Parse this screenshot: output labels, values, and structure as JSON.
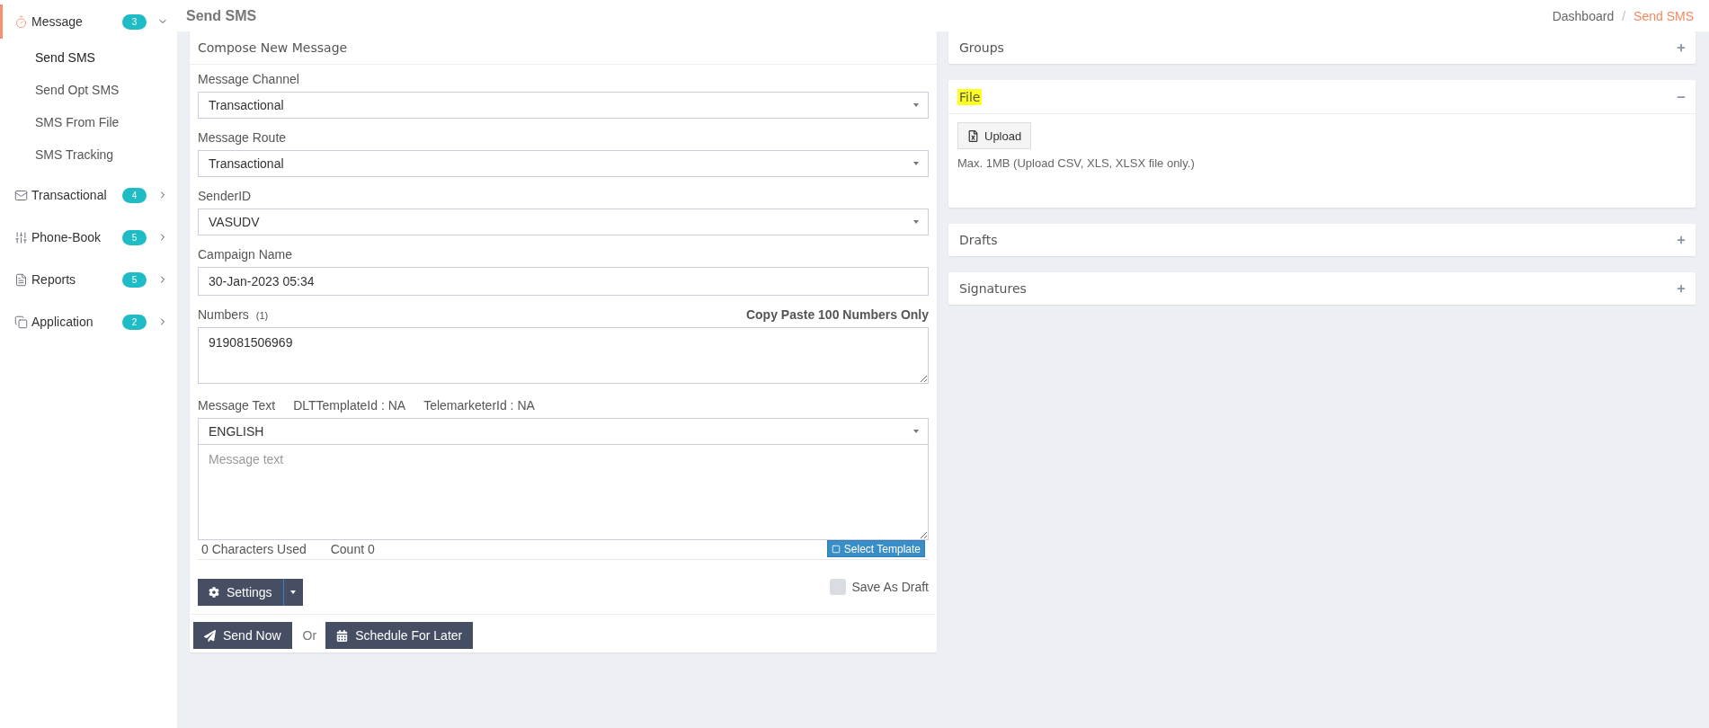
{
  "sidebar": {
    "items": [
      {
        "label": "Message",
        "badge": "3",
        "expanded": true,
        "selected": true,
        "children": [
          {
            "label": "Send SMS",
            "selected": true
          },
          {
            "label": "Send Opt SMS",
            "selected": false
          },
          {
            "label": "SMS From File",
            "selected": false
          },
          {
            "label": "SMS Tracking",
            "selected": false
          }
        ]
      },
      {
        "label": "Transactional",
        "badge": "4",
        "expanded": false,
        "selected": false
      },
      {
        "label": "Phone-Book",
        "badge": "5",
        "expanded": false,
        "selected": false
      },
      {
        "label": "Reports",
        "badge": "5",
        "expanded": false,
        "selected": false
      },
      {
        "label": "Application",
        "badge": "2",
        "expanded": false,
        "selected": false
      }
    ]
  },
  "header": {
    "title": "Send SMS",
    "breadcrumb_separator": "/",
    "breadcrumb": [
      {
        "label": "Dashboard",
        "selected": false
      },
      {
        "label": "Send SMS",
        "selected": true
      }
    ]
  },
  "compose": {
    "title": "Compose New Message",
    "fields": [
      {
        "kind": "select",
        "label": "Message Channel",
        "value": "Transactional"
      },
      {
        "kind": "select",
        "label": "Message Route",
        "value": "Transactional"
      },
      {
        "kind": "select",
        "label": "SenderID",
        "value": "VASUDV"
      },
      {
        "kind": "input",
        "label": "Campaign Name",
        "value": "30-Jan-2023 05:34"
      },
      {
        "kind": "textarea",
        "label": "Numbers",
        "count": "(1)",
        "hint": "Copy Paste 100 Numbers Only",
        "value": "919081506969"
      }
    ],
    "message": {
      "label": "Message Text",
      "dlt": "DLTTemplateId : NA",
      "telemarketer": "TelemarketerId : NA",
      "language": "ENGLISH",
      "placeholder": "Message text",
      "characters": "0 Characters Used",
      "count": "Count 0",
      "template_button": "Select Template"
    },
    "settings_button": "Settings",
    "save_draft": {
      "label": "Save As Draft",
      "checked": false
    },
    "send_button": "Send Now",
    "or": "Or",
    "schedule_button": "Schedule For Later"
  },
  "panels": [
    {
      "title": "Groups",
      "expanded": false,
      "highlighted": false
    },
    {
      "title": "File",
      "expanded": true,
      "highlighted": true,
      "upload_button": "Upload",
      "note": "Max. 1MB (Upload CSV, XLS, XLSX file only.)"
    },
    {
      "title": "Drafts",
      "expanded": false,
      "highlighted": false
    },
    {
      "title": "Signatures",
      "expanded": false,
      "highlighted": false
    }
  ]
}
